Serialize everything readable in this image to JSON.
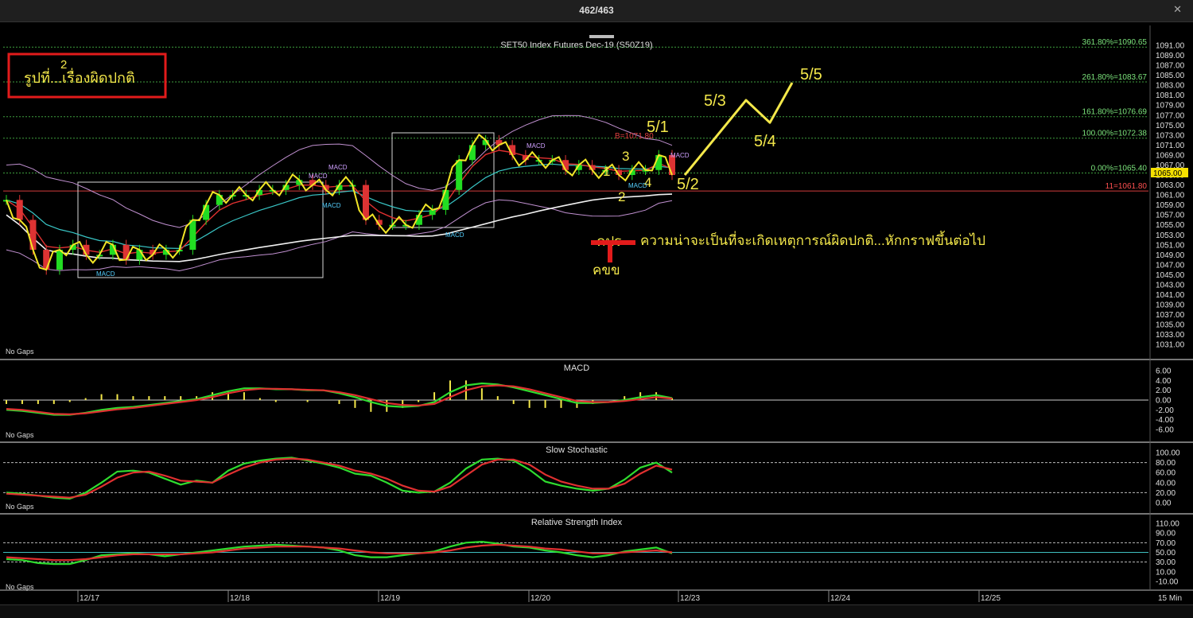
{
  "window": {
    "title": "462/463",
    "close_icon": "close-icon"
  },
  "colors": {
    "up_candle": "#22dd22",
    "down_candle": "#dd3333",
    "price_line": "#f2e626",
    "ema_red": "#e03030",
    "ema_cyan": "#39c6c6",
    "bollinger": "#c090d0",
    "ma_white": "#f0f0f0",
    "annotation_yellow": "#f4e84a",
    "fib_line": "#3f9f3f",
    "stop_line": "#d23c3c",
    "last_price_bg": "#f5e000",
    "macd_marker": "#cfa0ff",
    "macd_marker_buy": "#55d0ff"
  },
  "main": {
    "title": "SET50 Index Futures Dec-19 (S50Z19)",
    "no_gaps": "No Gaps",
    "label_box": {
      "line1": "2",
      "line2": "รูปที่...เรื่องผิดปกติ"
    },
    "fib_levels": [
      {
        "label": "361.80%=1090.65",
        "price": 1090.65
      },
      {
        "label": "261.80%=1083.67",
        "price": 1083.67
      },
      {
        "label": "161.80%=1076.69",
        "price": 1076.69
      },
      {
        "label": "100.00%=1072.38",
        "price": 1072.38
      },
      {
        "label": "0.00%=1065.40",
        "price": 1065.4
      }
    ],
    "stop_level": {
      "label": "11=1061.80",
      "price": 1061.8
    },
    "b_label": "B=1071.80",
    "last_price": "1065.00",
    "annotation_text": "ความน่าจะเป็นที่จะเกิดเหตุการณ์ผิดปกติ...หักกราฟขึ้นต่อไป",
    "annotation_prefix": "คปร",
    "stop_caption": "คขข",
    "wave_labels": [
      "1",
      "2",
      "3",
      "4",
      "5/1",
      "5/2",
      "5/3",
      "5/4",
      "5/5"
    ],
    "macd_marker": "MACD",
    "y_ticks": [
      "1091.00",
      "1089.00",
      "1087.00",
      "1085.00",
      "1083.00",
      "1081.00",
      "1079.00",
      "1077.00",
      "1075.00",
      "1073.00",
      "1071.00",
      "1069.00",
      "1067.00",
      "1065.00",
      "1063.00",
      "1061.00",
      "1059.00",
      "1057.00",
      "1055.00",
      "1053.00",
      "1051.00",
      "1049.00",
      "1047.00",
      "1045.00",
      "1043.00",
      "1041.00",
      "1039.00",
      "1037.00",
      "1035.00",
      "1033.00",
      "1031.00"
    ]
  },
  "panels": {
    "macd": {
      "title": "MACD",
      "no_gaps": "No Gaps",
      "y_ticks": [
        "6.00",
        "4.00",
        "2.00",
        "0.00",
        "-2.00",
        "-4.00",
        "-6.00"
      ]
    },
    "stoch": {
      "title": "Slow Stochastic",
      "no_gaps": "No Gaps",
      "y_ticks": [
        "100.00",
        "80.00",
        "60.00",
        "40.00",
        "20.00",
        "0.00"
      ]
    },
    "rsi": {
      "title": "Relative Strength Index",
      "no_gaps": "No Gaps",
      "y_ticks": [
        "110.00",
        "90.00",
        "70.00",
        "50.00",
        "30.00",
        "10.00",
        "-10.00"
      ]
    }
  },
  "x_axis": {
    "labels": [
      "12/17",
      "12/18",
      "12/19",
      "12/20",
      "12/23",
      "12/24",
      "12/25"
    ],
    "interval": "15 Min"
  },
  "chart_data": [
    {
      "type": "line",
      "title": "SET50 Index Futures Dec-19 (S50Z19)",
      "x": [
        "12/17",
        "12/18",
        "12/19",
        "12/20",
        "12/23"
      ],
      "ylim": [
        1030,
        1092
      ],
      "series": [
        {
          "values": [
            1060,
            1056,
            1050,
            1046,
            1050,
            1051,
            1049,
            1049,
            1051,
            1048,
            1050,
            1049,
            1050,
            1050,
            1056,
            1059,
            1061,
            1061,
            1061,
            1062,
            1062,
            1063,
            1064,
            1063,
            1062,
            1063,
            1063,
            1056,
            1055,
            1055,
            1055,
            1057,
            1058,
            1062,
            1068,
            1071,
            1072,
            1071,
            1069,
            1068,
            1068,
            1068,
            1066,
            1067,
            1066,
            1066,
            1065,
            1066,
            1066,
            1069,
            1065
          ]
        }
      ],
      "projection": [
        {
          "label": "5/2",
          "price": 1065.0
        },
        {
          "label": "5/3",
          "price": 1080.0
        },
        {
          "label": "5/4",
          "price": 1075.5
        },
        {
          "label": "5/5",
          "price": 1083.5
        }
      ]
    },
    {
      "type": "line",
      "title": "MACD",
      "ylim": [
        -6,
        6
      ],
      "series": [
        {
          "values": [
            -2.0,
            -2.2,
            -2.6,
            -3.0,
            -3.0,
            -2.6,
            -2.0,
            -1.6,
            -1.4,
            -1.0,
            -0.6,
            -0.2,
            0.2,
            1.0,
            1.8,
            2.4,
            2.4,
            2.2,
            2.2,
            2.0,
            2.0,
            1.4,
            0.6,
            -0.4,
            -1.2,
            -1.4,
            -1.2,
            -0.4,
            1.6,
            3.0,
            3.4,
            3.2,
            2.6,
            1.8,
            1.0,
            0.2,
            -0.6,
            -0.6,
            -0.4,
            0.0,
            0.6,
            1.0,
            0.4
          ]
        },
        {
          "values": [
            -1.8,
            -2.0,
            -2.4,
            -2.8,
            -2.9,
            -2.7,
            -2.3,
            -1.9,
            -1.6,
            -1.2,
            -0.8,
            -0.4,
            0.0,
            0.6,
            1.4,
            2.0,
            2.3,
            2.3,
            2.2,
            2.1,
            2.0,
            1.6,
            1.0,
            0.2,
            -0.6,
            -1.0,
            -1.1,
            -0.8,
            0.6,
            2.0,
            2.8,
            3.0,
            2.8,
            2.2,
            1.4,
            0.6,
            -0.2,
            -0.4,
            -0.4,
            -0.2,
            0.2,
            0.6,
            0.3
          ]
        }
      ]
    },
    {
      "type": "line",
      "title": "Slow Stochastic",
      "ylim": [
        0,
        100
      ],
      "series": [
        {
          "values": [
            20,
            18,
            14,
            10,
            8,
            20,
            40,
            62,
            64,
            60,
            48,
            36,
            44,
            40,
            64,
            78,
            84,
            88,
            90,
            84,
            78,
            70,
            58,
            54,
            40,
            24,
            20,
            22,
            40,
            68,
            86,
            88,
            84,
            66,
            42,
            34,
            28,
            24,
            28,
            46,
            70,
            80,
            60
          ]
        },
        {
          "values": [
            18,
            16,
            14,
            12,
            10,
            16,
            32,
            50,
            60,
            62,
            54,
            44,
            42,
            40,
            56,
            70,
            80,
            86,
            88,
            86,
            80,
            74,
            64,
            58,
            48,
            34,
            24,
            22,
            32,
            54,
            76,
            86,
            86,
            76,
            56,
            42,
            34,
            28,
            28,
            38,
            58,
            74,
            66
          ]
        }
      ]
    },
    {
      "type": "line",
      "title": "Relative Strength Index",
      "ylim": [
        -10,
        110
      ],
      "series": [
        {
          "values": [
            36,
            34,
            28,
            26,
            26,
            34,
            44,
            46,
            48,
            46,
            42,
            46,
            50,
            54,
            58,
            62,
            64,
            66,
            64,
            62,
            60,
            54,
            44,
            40,
            40,
            44,
            48,
            52,
            62,
            70,
            72,
            68,
            62,
            60,
            54,
            50,
            44,
            40,
            44,
            52,
            56,
            60,
            48
          ]
        },
        {
          "values": [
            40,
            38,
            36,
            34,
            34,
            36,
            40,
            44,
            46,
            46,
            46,
            46,
            48,
            50,
            54,
            58,
            60,
            62,
            62,
            62,
            60,
            58,
            54,
            50,
            48,
            48,
            48,
            50,
            54,
            60,
            64,
            66,
            64,
            62,
            58,
            56,
            52,
            48,
            48,
            50,
            52,
            54,
            50
          ]
        }
      ]
    }
  ]
}
